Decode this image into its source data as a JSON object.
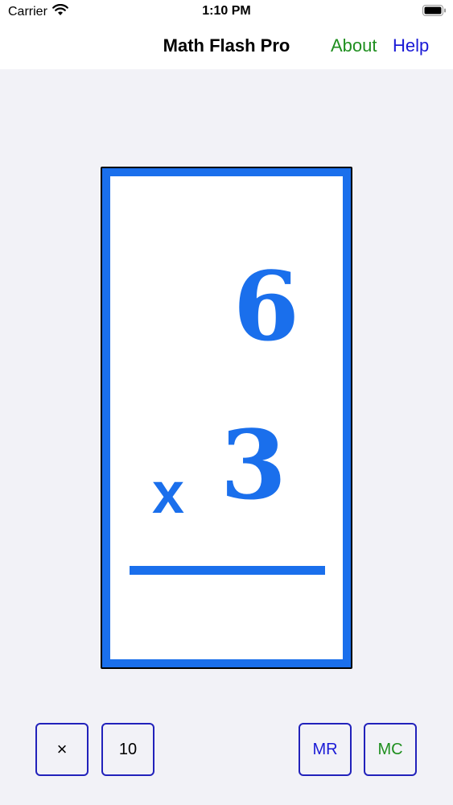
{
  "status_bar": {
    "carrier": "Carrier",
    "time": "1:10 PM"
  },
  "nav": {
    "title": "Math Flash Pro",
    "about": "About",
    "help": "Help",
    "colors": {
      "about": "#1f8f1f",
      "help": "#1a1ad6"
    }
  },
  "card": {
    "top_number": "6",
    "operator": "x",
    "bottom_number": "3",
    "color": "#1a6fec"
  },
  "buttons": {
    "operator": "×",
    "max_number": "10",
    "memory_recall": "MR",
    "memory_clear": "MC"
  },
  "icons": {
    "wifi": "wifi-icon",
    "battery": "battery-icon"
  }
}
